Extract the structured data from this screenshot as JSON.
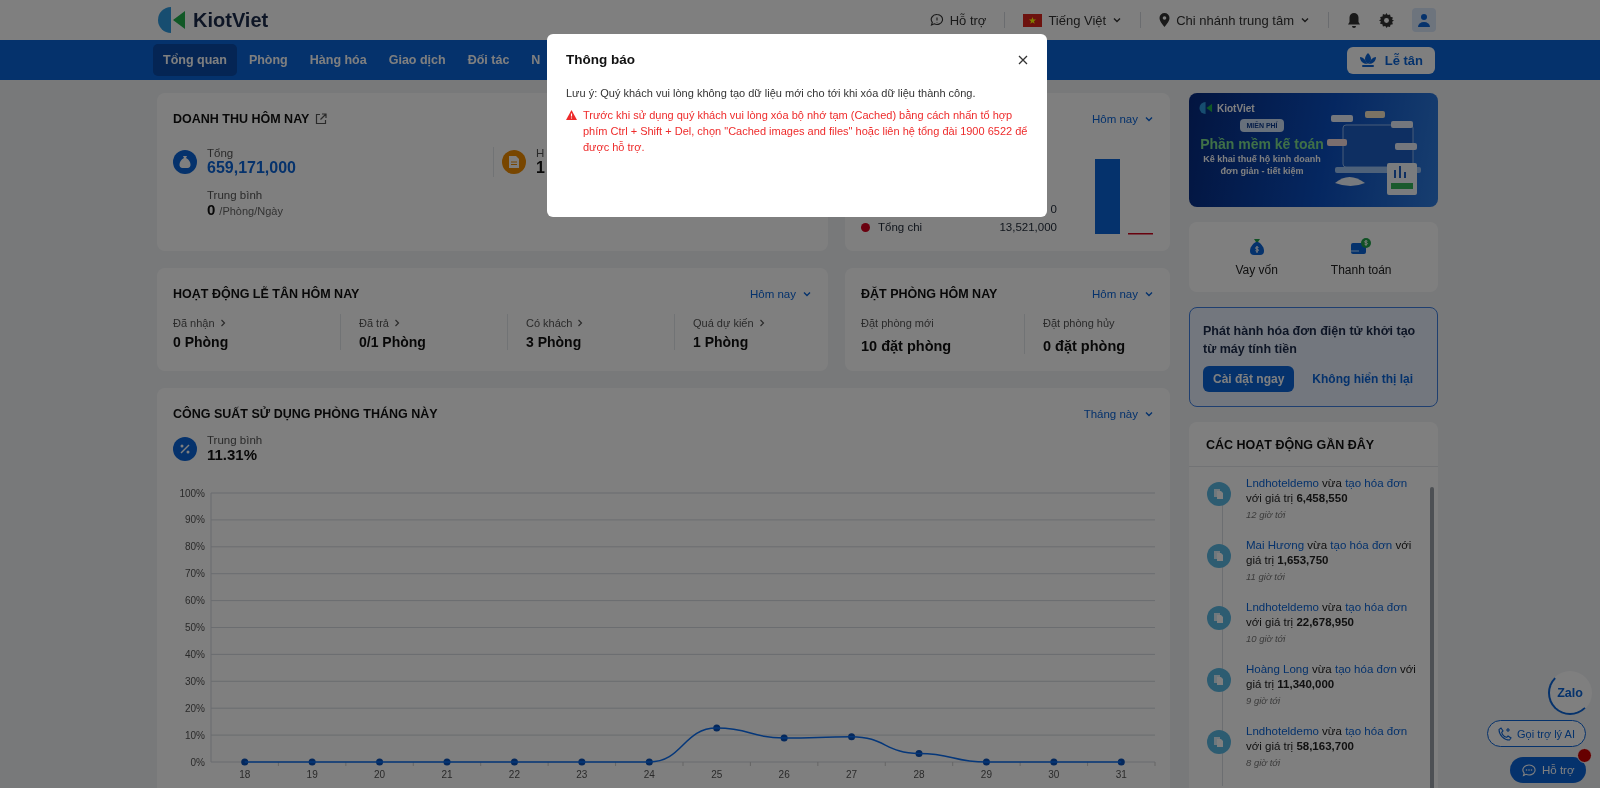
{
  "header": {
    "logo": "KiotViet",
    "support": "Hỗ trợ",
    "language": "Tiếng Việt",
    "branch": "Chi nhánh trung tâm"
  },
  "nav": {
    "items": [
      {
        "label": "Tổng quan",
        "selected": true
      },
      {
        "label": "Phòng",
        "selected": false
      },
      {
        "label": "Hàng hóa",
        "selected": false
      },
      {
        "label": "Giao dịch",
        "selected": false
      },
      {
        "label": "Đối tác",
        "selected": false
      },
      {
        "label": "N",
        "selected": false
      }
    ],
    "reception_button": "Lễ tân"
  },
  "revenue_card": {
    "title": "DOANH THU HÔM NAY",
    "total_label": "Tổng",
    "total_value": "659,171,000",
    "second_label": "H",
    "second_value": "1",
    "average_label": "Trung bình",
    "average_value": "0",
    "average_unit": "/Phòng/Ngày"
  },
  "expense_card": {
    "period": "Hôm nay",
    "partial_value": "0",
    "legend": [
      {
        "label": "Tổng chi",
        "value": "13,521,000",
        "color": "#6a000f"
      }
    ]
  },
  "reception_card": {
    "title": "HOẠT ĐỘNG LỄ TÂN HÔM NAY",
    "period": "Hôm nay",
    "stats": [
      {
        "label": "Đã nhận",
        "value": "0 Phòng"
      },
      {
        "label": "Đã trả",
        "value": "0/1 Phòng"
      },
      {
        "label": "Có khách",
        "value": "3 Phòng"
      },
      {
        "label": "Quá dự kiến",
        "value": "1 Phòng"
      }
    ]
  },
  "booking_card": {
    "title": "ĐẶT PHÒNG HÔM NAY",
    "period": "Hôm nay",
    "stats": [
      {
        "label": "Đặt phòng mới",
        "value": "10 đặt phòng"
      },
      {
        "label": "Đặt phòng hủy",
        "value": "0 đặt phòng"
      }
    ]
  },
  "occupancy_card": {
    "title": "CÔNG SUẤT SỬ DỤNG PHÒNG THÁNG NÀY",
    "period": "Tháng này",
    "average_label": "Trung bình",
    "average_value": "11.31%",
    "chart_data": {
      "type": "line",
      "categories": [
        "18",
        "19",
        "20",
        "21",
        "22",
        "23",
        "24",
        "25",
        "26",
        "27",
        "28",
        "29",
        "30",
        "31"
      ],
      "series": [
        {
          "color": "#05377a",
          "values": [
            0,
            0,
            0,
            0,
            0,
            0,
            0,
            12.6,
            8.9,
            9.4,
            3.2,
            0,
            0,
            0
          ]
        }
      ],
      "grid": true,
      "marker": true,
      "ylim": [
        0,
        100
      ],
      "yticks": [
        {
          "value": 0,
          "label": "0%"
        },
        {
          "value": 10,
          "label": "10%"
        },
        {
          "value": 20,
          "label": "20%"
        },
        {
          "value": 30,
          "label": "30%"
        },
        {
          "value": 40,
          "label": "40%"
        },
        {
          "value": 50,
          "label": "50%"
        },
        {
          "value": 60,
          "label": "60%"
        },
        {
          "value": 70,
          "label": "70%"
        },
        {
          "value": 80,
          "label": "80%"
        },
        {
          "value": 90,
          "label": "90%"
        },
        {
          "value": 100,
          "label": "100%"
        }
      ]
    }
  },
  "banner": {
    "brand": "KiotViet",
    "badge": "MIỄN PHÍ",
    "headline": "Phần mềm kế toán",
    "subline_1": "Kê khai thuế hộ kinh doanh",
    "subline_2": "đơn giản - tiết kiệm"
  },
  "quick_actions": [
    {
      "label": "Vay vốn",
      "kind": "loan"
    },
    {
      "label": "Thanh toán",
      "kind": "payment"
    }
  ],
  "promo": {
    "text": "Phát hành hóa đơn điện tử khởi tạo từ máy tính tiền",
    "primary_button": "Cài đặt ngay",
    "secondary_link": "Không hiển thị lại"
  },
  "activity": {
    "title": "CÁC HOẠT ĐỘNG GẦN ĐÂY",
    "items": [
      {
        "actor": "Lndhoteldemo",
        "verb": "vừa",
        "action": "tạo hóa đơn",
        "prefix": "với giá trị",
        "amount": "6,458,550",
        "time": "12 giờ tới"
      },
      {
        "actor": "Mai Hương",
        "verb": "vừa",
        "action": "tạo hóa đơn",
        "prefix": "với giá trị",
        "amount": "1,653,750",
        "time": "11 giờ tới"
      },
      {
        "actor": "Lndhoteldemo",
        "verb": "vừa",
        "action": "tạo hóa đơn",
        "prefix": "với giá trị",
        "amount": "22,678,950",
        "time": "10 giờ tới"
      },
      {
        "actor": "Hoàng Long",
        "verb": "vừa",
        "action": "tạo hóa đơn",
        "prefix": "với giá trị",
        "amount": "11,340,000",
        "time": "9 giờ tới"
      },
      {
        "actor": "Lndhoteldemo",
        "verb": "vừa",
        "action": "tạo hóa đơn",
        "prefix": "với giá trị",
        "amount": "58,163,700",
        "time": "8 giờ tới"
      }
    ]
  },
  "floating": {
    "zalo": "Zalo",
    "ai_button": "Gọi trợ lý AI",
    "support_button": "Hỗ trợ"
  },
  "modal": {
    "title": "Thông báo",
    "note": "Lưu ý: Quý khách vui lòng không tạo dữ liệu mới cho tới khi xóa dữ liệu thành công.",
    "warning": "Trước khi sử dụng quý khách vui lòng xóa bộ nhớ tạm (Cached) bằng cách nhấn tổ hợp phím Ctrl + Shift + Del, chọn \"Cached images and files\" hoặc liên hệ tổng đài 1900 6522 để được hỗ trợ."
  }
}
